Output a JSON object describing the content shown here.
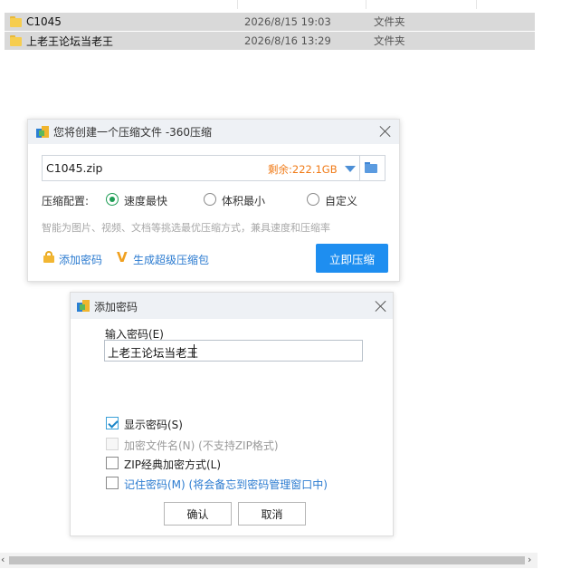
{
  "files": [
    {
      "name": "C1045",
      "date": "2026/8/15 19:03",
      "type": "文件夹"
    },
    {
      "name": "上老王论坛当老王",
      "date": "2026/8/16 13:29",
      "type": "文件夹"
    }
  ],
  "compress_dialog": {
    "title": "您将创建一个压缩文件 -360压缩",
    "filename": "C1045.zip",
    "free_space": "剩余:222.1GB",
    "config_label": "压缩配置:",
    "options": [
      {
        "label": "速度最快",
        "selected": true
      },
      {
        "label": "体积最小",
        "selected": false
      },
      {
        "label": "自定义",
        "selected": false
      }
    ],
    "hint": "智能为图片、视频、文档等挑选最优压缩方式，兼具速度和压缩率",
    "add_password_label": "添加密码",
    "super_pack_label": "生成超级压缩包",
    "compress_button": "立即压缩",
    "accent_color": "#1e8ef0",
    "free_space_color": "#f07a16"
  },
  "password_dialog": {
    "title": "添加密码",
    "input_label": "输入密码(E)",
    "password_value": "上老王论坛当老王",
    "options": [
      {
        "label": "显示密码(S)",
        "checked": true,
        "enabled": true
      },
      {
        "label": "加密文件名(N) (不支持ZIP格式)",
        "checked": false,
        "enabled": false
      },
      {
        "label": "ZIP经典加密方式(L)",
        "checked": false,
        "enabled": true
      },
      {
        "label": "记住密码(M) (将会备忘到密码管理窗口中)",
        "checked": false,
        "enabled": true
      }
    ],
    "ok_button": "确认",
    "cancel_button": "取消"
  },
  "scrollbar": {
    "left_arrow": "‹",
    "right_arrow": "›"
  }
}
